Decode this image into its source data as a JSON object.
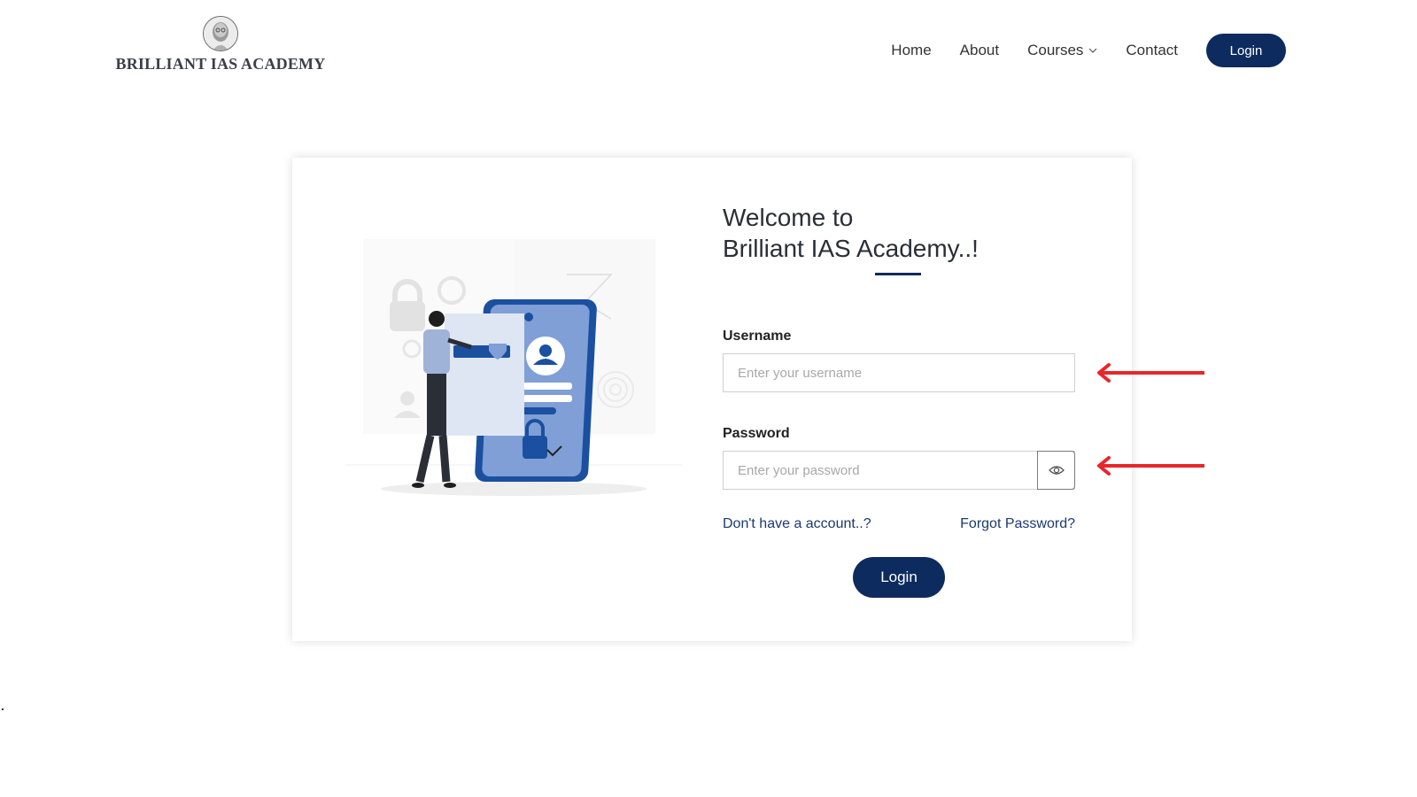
{
  "brand": {
    "name": "BRILLIANT IAS ACADEMY"
  },
  "nav": {
    "items": [
      {
        "label": "Home"
      },
      {
        "label": "About"
      },
      {
        "label": "Courses"
      },
      {
        "label": "Contact"
      }
    ],
    "login_label": "Login"
  },
  "login_form": {
    "welcome_line1": "Welcome to",
    "welcome_line2": "Brilliant IAS Academy..!",
    "username": {
      "label": "Username",
      "placeholder": "Enter your username",
      "value": ""
    },
    "password": {
      "label": "Password",
      "placeholder": "Enter your password",
      "value": ""
    },
    "signup_link": "Don't have a account..?",
    "forgot_link": "Forgot Password?",
    "submit_label": "Login"
  },
  "colors": {
    "primary": "#0d2b5e",
    "annotation_arrow": "#e8262b",
    "illustration_blue": "#7f9fd6"
  }
}
